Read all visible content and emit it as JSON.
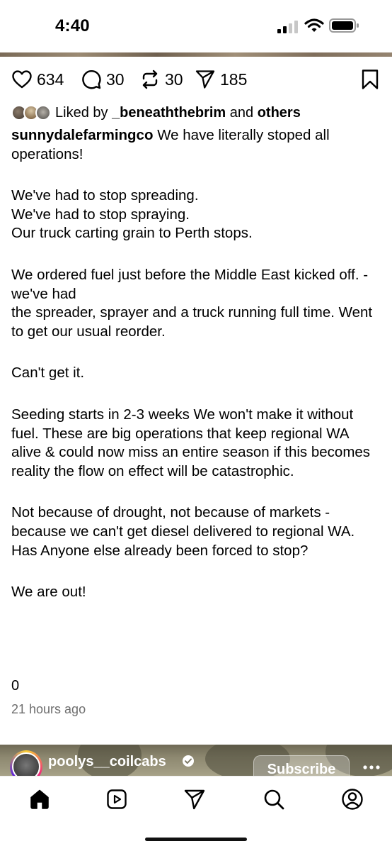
{
  "status_bar": {
    "time": "4:40"
  },
  "actions": {
    "likes": "634",
    "comments": "30",
    "reposts": "30",
    "shares": "185"
  },
  "liked_by": {
    "prefix": "Liked by ",
    "user": "_beneaththebrim",
    "conjunction": " and ",
    "others": "others"
  },
  "caption": {
    "username": "sunnydalefarmingco",
    "first_line": " We have literally stoped all operations!",
    "p2_l1": "We've had to stop spreading.",
    "p2_l2": "We've had to stop spraying.",
    "p2_l3": "Our truck carting grain to Perth stops.",
    "p3_l1": "We ordered fuel just before the Middle East kicked off. - we've had",
    "p3_l2": "the spreader,  sprayer and a truck running full time. Went to get our usual reorder.",
    "p4": "Can't get it.",
    "p5": "Seeding starts in 2-3 weeks We won't make it without fuel. These are big operations that keep regional WA alive & could now miss an entire season if this becomes reality the flow on effect will be catastrophic.",
    "p6_l1": "Not because of drought, not because of markets - because we can't get diesel delivered to regional WA.",
    "p6_l2": "Has Anyone else already been forced to stop?",
    "p7": "We are out!"
  },
  "comment_count": "0",
  "timestamp": "21 hours ago",
  "next_post": {
    "username": "poolys__coilcabs",
    "subscribe_label": "Subscribe"
  },
  "colors": {
    "text": "#000000",
    "muted": "#6e6e6e",
    "background": "#ffffff"
  },
  "icons": [
    "heart-icon",
    "comment-icon",
    "repost-icon",
    "share-icon",
    "bookmark-icon",
    "home-icon",
    "reels-icon",
    "send-icon",
    "search-icon",
    "profile-icon",
    "verified-icon",
    "more-icon"
  ]
}
